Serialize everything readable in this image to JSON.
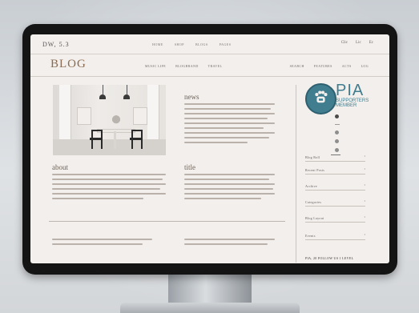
{
  "topbar": {
    "brand": "DW, 5.3",
    "nav": [
      "HOME",
      "SHOP",
      "BLOGS",
      "PAGES"
    ],
    "right": [
      "Clic",
      "Lic",
      "Ec"
    ]
  },
  "header": {
    "logo": "BLOG",
    "mid_nav": [
      "MUSIC LIFE",
      "BLOGBRAND",
      "TRAVEL"
    ],
    "right_nav": [
      "SEARCH",
      "FEATURES",
      "ACTS",
      "LOG"
    ]
  },
  "main": {
    "hero_alt": "dining room photo",
    "news_title": "news",
    "about_title": "about",
    "title_title": "title"
  },
  "sidebar": {
    "logo_text": "PIA",
    "logo_sub_1": "SUPPORTERS",
    "logo_sub_2": "MEMBER",
    "rows": [
      "Blog Roll",
      "Recent Posts",
      "Archive",
      "Categories",
      "Blog Layout",
      "Events"
    ],
    "footer": "PIA, 20 FOLLOW US 1 LEVEL"
  },
  "colors": {
    "brand": "#8a6b52",
    "pia_accent": "#3f7d8f",
    "screen_bg": "#f3efec"
  }
}
